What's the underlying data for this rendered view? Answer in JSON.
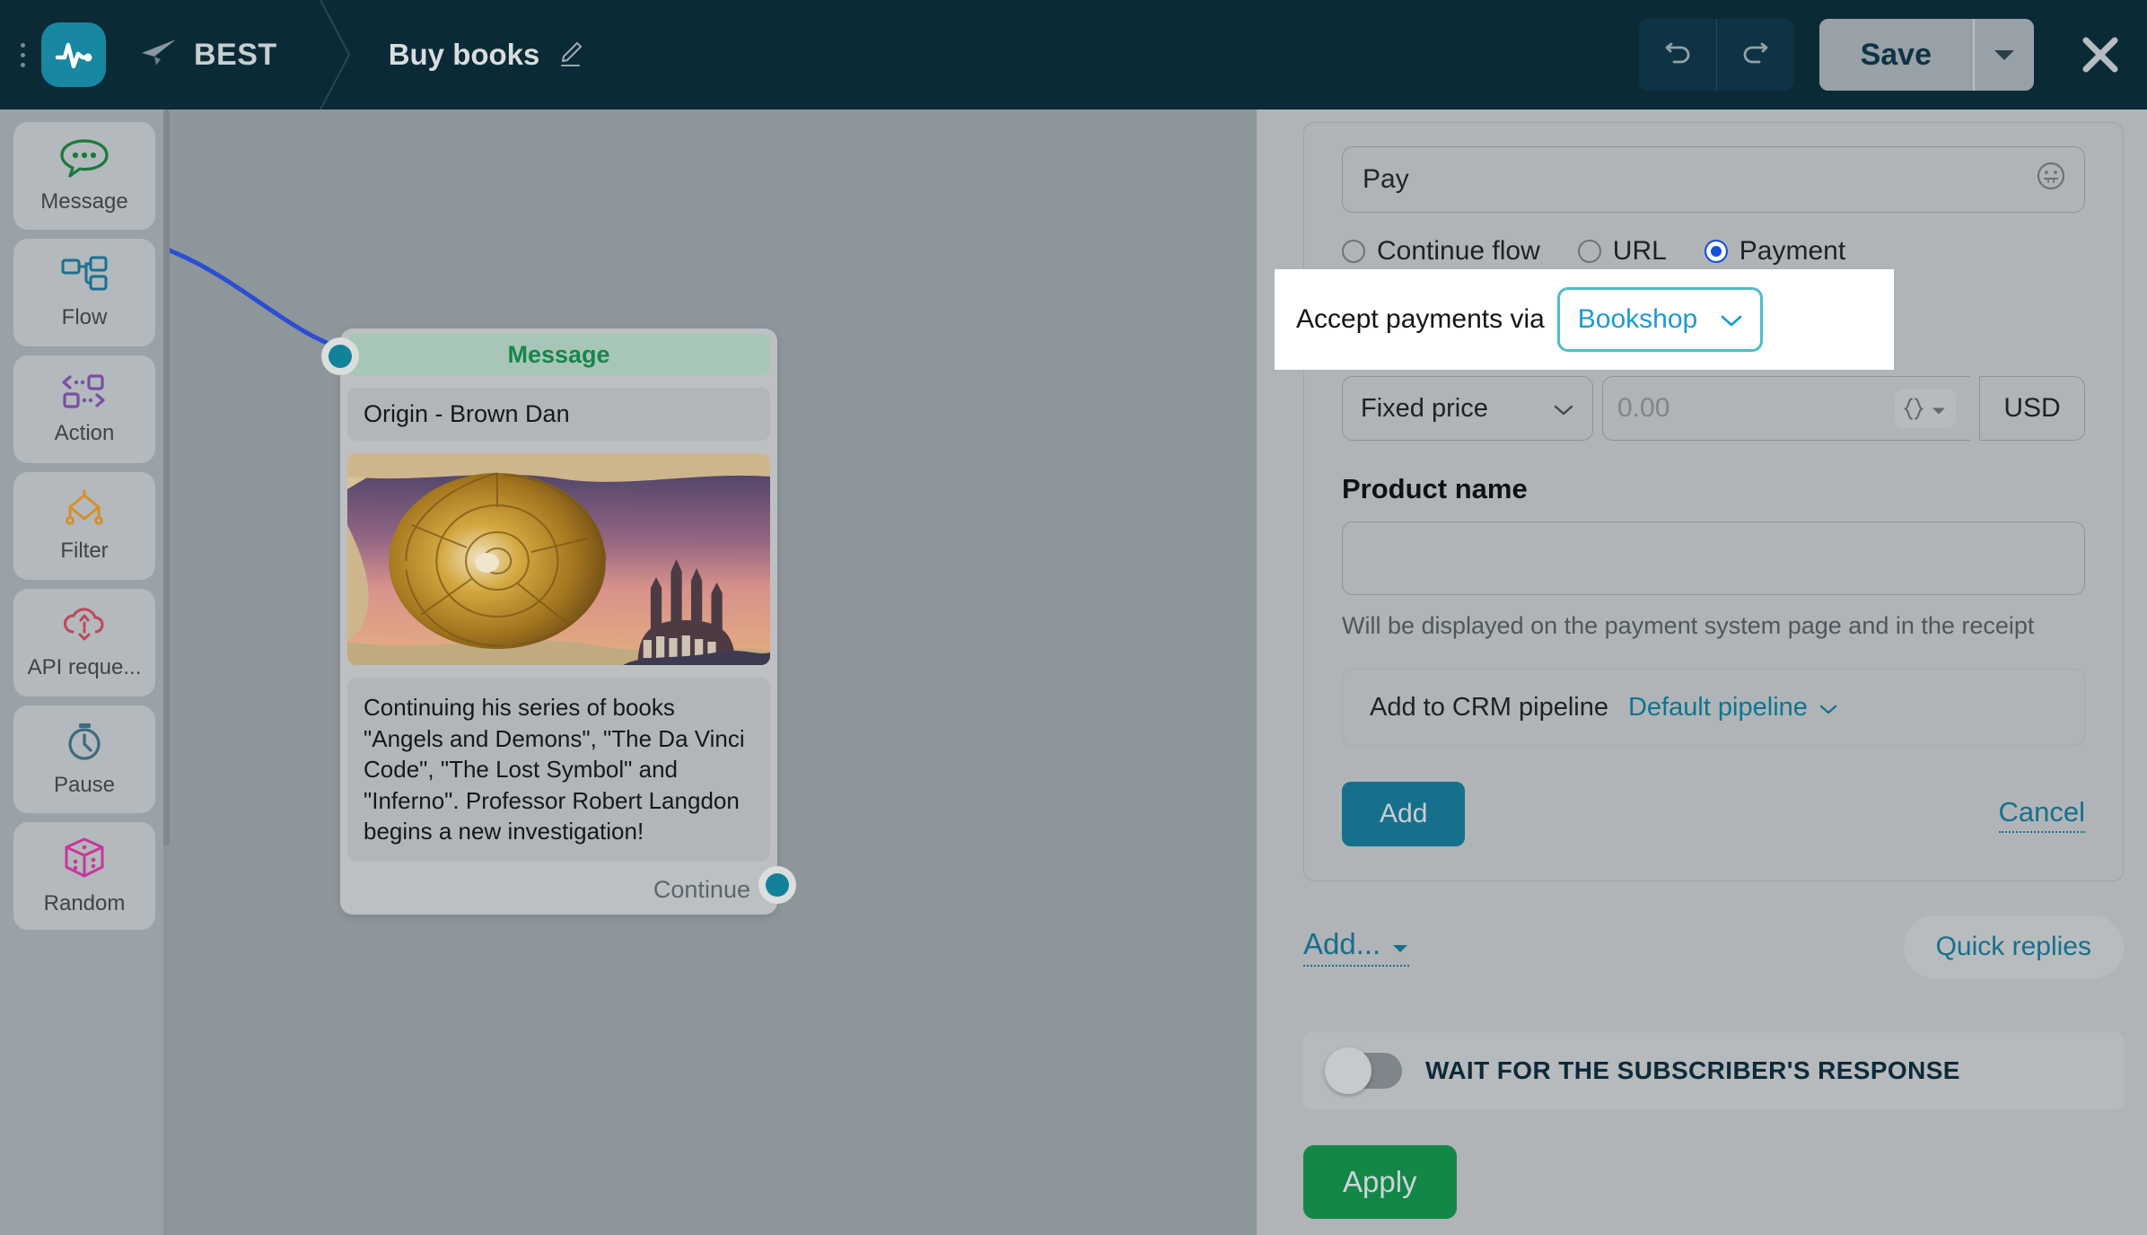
{
  "topbar": {
    "brand": "BEST",
    "doc_title": "Buy books",
    "edit_icon": "pencil-icon",
    "telegram_icon": "telegram-plane-icon",
    "logo_icon": "pulse-logo-icon",
    "menu_icon": "kebab-menu-icon",
    "undo_icon": "undo-arrow-icon",
    "redo_icon": "redo-arrow-icon",
    "save_label": "Save",
    "save_caret_icon": "caret-down-icon",
    "close_icon": "close-x-icon",
    "bg_color": "#0a2a36",
    "logo_color": "#1787a2"
  },
  "sidebar": {
    "items": [
      {
        "label": "Message",
        "icon": "chat-bubble-icon",
        "color": "#1a7a3c"
      },
      {
        "label": "Flow",
        "icon": "flow-nodes-icon",
        "color": "#1b6f92"
      },
      {
        "label": "Action",
        "icon": "action-arrows-icon",
        "color": "#7a4fa3"
      },
      {
        "label": "Filter",
        "icon": "filter-diamond-icon",
        "color": "#d49029"
      },
      {
        "label": "API reque...",
        "icon": "cloud-api-icon",
        "color": "#c0455a"
      },
      {
        "label": "Pause",
        "icon": "stopwatch-icon",
        "color": "#3d6b7d"
      },
      {
        "label": "Random",
        "icon": "dice-cube-icon",
        "color": "#c7379b"
      }
    ]
  },
  "canvas": {
    "node": {
      "header": "Message",
      "subtitle": "Origin - Brown Dan",
      "image_alt": "nautilus-shell-sagrada-familia-collage",
      "body": "Continuing his series of books \"Angels and Demons\", \"The Da Vinci Code\", \"The Lost Symbol\" and \"Inferno\". Professor Robert Langdon begins a new investigation!",
      "continue_label": "Continue",
      "port_color": "#12829b",
      "header_bg": "#a8c6b7",
      "header_text_color": "#18854b"
    },
    "edge_color": "#2b4fd1"
  },
  "panel": {
    "button_text": {
      "value": "Pay",
      "emoji_icon": "smiley-icon"
    },
    "button_type": {
      "options": [
        "Continue flow",
        "URL",
        "Payment"
      ],
      "selected": "Payment",
      "selected_color": "#1652d8"
    },
    "payment_via": {
      "label": "Accept payments via",
      "value": "Bookshop",
      "chevron_icon": "chevron-down-icon",
      "highlight_border": "#4fbcc8",
      "value_color": "#1b9ad3"
    },
    "price": {
      "mode": "Fixed price",
      "mode_chevron_icon": "chevron-down-icon",
      "amount_placeholder": "0.00",
      "variable_icon": "curly-braces-icon",
      "variable_caret_icon": "caret-down-icon",
      "currency": "USD"
    },
    "product": {
      "title": "Product name",
      "value": "",
      "hint": "Will be displayed on the payment system page and in the receipt"
    },
    "crm": {
      "label": "Add to CRM pipeline",
      "value": "Default pipeline",
      "chevron_icon": "chevron-down-icon"
    },
    "actions": {
      "add_label": "Add",
      "cancel_label": "Cancel"
    },
    "footer": {
      "add_more_label": "Add...",
      "add_more_caret_icon": "caret-down-icon",
      "quick_replies_label": "Quick replies",
      "wait_label": "WAIT FOR THE SUBSCRIBER'S RESPONSE",
      "wait_enabled": false,
      "apply_label": "Apply",
      "apply_color": "#128748"
    }
  }
}
